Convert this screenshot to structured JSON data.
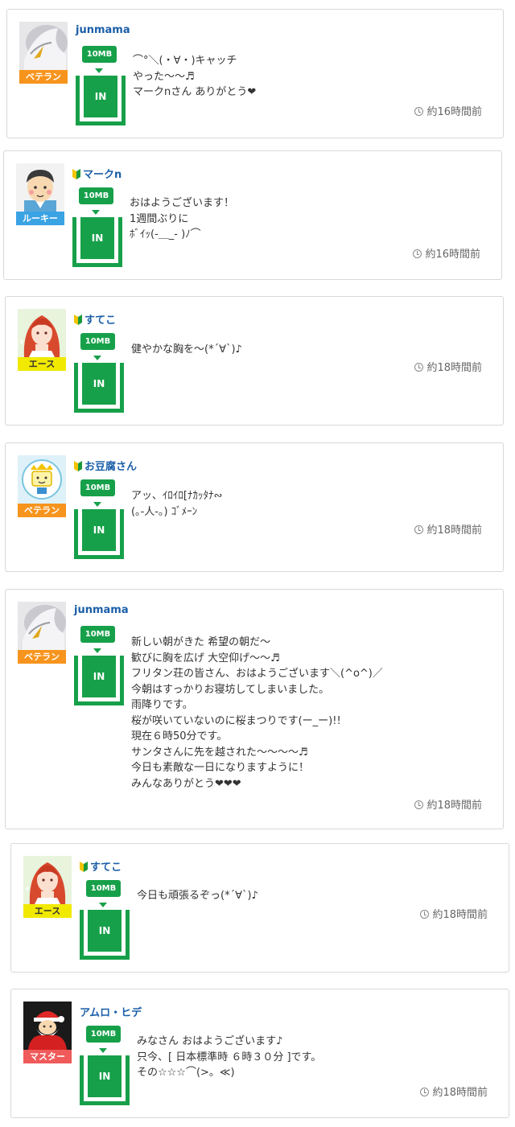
{
  "posts": [
    {
      "username": "junmama",
      "beginner": false,
      "rank": "ベテラン",
      "badge": "10MB",
      "in_label": "IN",
      "lines": [
        "⌒°＼(・∀・)キャッチ",
        "やった〜〜♬",
        "マークnさん ありがとう❤"
      ],
      "time": "約16時間前"
    },
    {
      "username": "マークn",
      "beginner": true,
      "rank": "ルーキー",
      "badge": "10MB",
      "in_label": "IN",
      "lines": [
        "おはようございます！",
        "1週間ぶりに",
        "ﾎﾞｲｯ(-＿_- )ﾉ⌒"
      ],
      "time": "約16時間前"
    },
    {
      "username": "すてこ",
      "beginner": true,
      "rank": "エース",
      "badge": "10MB",
      "in_label": "IN",
      "lines": [
        "健やかな胸を〜(*´∀`)♪"
      ],
      "time": "約18時間前"
    },
    {
      "username": "お豆腐さん",
      "beginner": true,
      "rank": "ベテラン",
      "badge": "10MB",
      "in_label": "IN",
      "lines": [
        "アッ、ｲﾛｲﾛ[ﾅｶｯﾀﾅ∾",
        "(｡-人-｡) ｺﾞﾒｰﾝ"
      ],
      "time": "約18時間前"
    },
    {
      "username": "junmama",
      "beginner": false,
      "rank": "ベテラン",
      "badge": "10MB",
      "in_label": "IN",
      "lines": [
        "新しい朝がきた 希望の朝だ〜",
        "歓びに胸を広げ 大空仰げ〜〜♬",
        "フリタン荘の皆さん、おはようございます＼(^o^)／",
        "今朝はすっかりお寝坊してしまいました。",
        "雨降りです。",
        "桜が咲いていないのに桜まつりです(ー_ー)!!",
        "現在６時50分です。",
        "サンタさんに先を越された〜〜〜〜♬",
        "今日も素敵な一日になりますように！",
        "みんなありがとう❤❤❤"
      ],
      "time": "約18時間前"
    },
    {
      "username": "すてこ",
      "beginner": true,
      "rank": "エース",
      "badge": "10MB",
      "in_label": "IN",
      "lines": [
        "今日も頑張るぞっ(*´∀`)♪"
      ],
      "time": "約18時間前"
    },
    {
      "username": "アムロ・ヒデ",
      "beginner": false,
      "rank": "マスター",
      "badge": "10MB",
      "in_label": "IN",
      "lines": [
        "みなさん おはようございます♪",
        "只今、[ 日本標準時 ６時３０分 ]です。",
        "その☆☆☆⌒(>。≪)"
      ],
      "time": "約18時間前"
    }
  ],
  "colors": {
    "accent_green": "#17a04a",
    "username_blue": "#1a5ea8"
  },
  "icons": {
    "time": "clock-icon",
    "beginner": "beginner-mark-icon"
  }
}
